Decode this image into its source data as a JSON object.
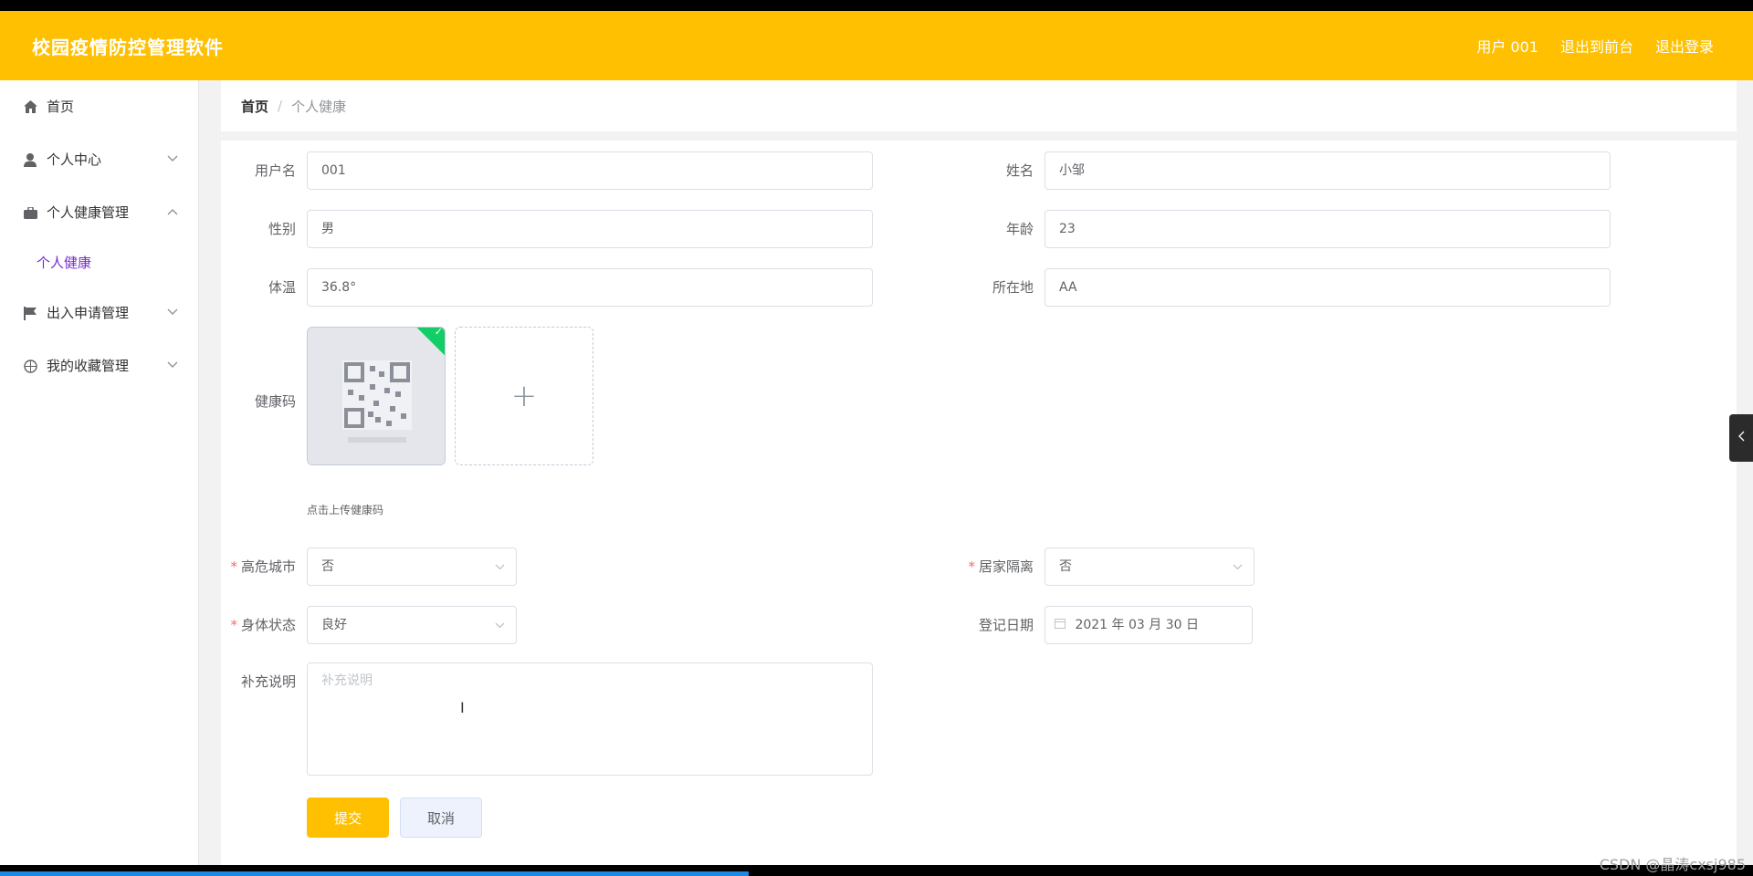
{
  "app": {
    "title": "校园疫情防控管理软件"
  },
  "topnav": {
    "user": "用户 001",
    "front": "退出到前台",
    "logout": "退出登录"
  },
  "sidebar": {
    "items": [
      {
        "label": "首页",
        "icon": "home-icon"
      },
      {
        "label": "个人中心",
        "icon": "user-icon",
        "arrow": "down"
      },
      {
        "label": "个人健康管理",
        "icon": "briefcase-icon",
        "arrow": "up"
      },
      {
        "label": "出入申请管理",
        "icon": "flag-icon",
        "arrow": "down"
      },
      {
        "label": "我的收藏管理",
        "icon": "compass-icon",
        "arrow": "down"
      }
    ],
    "sub": {
      "label": "个人健康"
    }
  },
  "breadcrumb": {
    "home": "首页",
    "separator": "/",
    "current": "个人健康"
  },
  "form": {
    "username": {
      "label": "用户名",
      "value": "001"
    },
    "name": {
      "label": "姓名",
      "value": "小邹"
    },
    "gender": {
      "label": "性别",
      "value": "男"
    },
    "age": {
      "label": "年龄",
      "value": "23"
    },
    "temperature": {
      "label": "体温",
      "value": "36.8°"
    },
    "location": {
      "label": "所在地",
      "value": "AA"
    },
    "healthcode": {
      "label": "健康码",
      "tip": "点击上传健康码",
      "add": "+"
    },
    "risk_city": {
      "label": "高危城市",
      "value": "否"
    },
    "home_quarantine": {
      "label": "居家隔离",
      "value": "否"
    },
    "body_status": {
      "label": "身体状态",
      "value": "良好"
    },
    "reg_date": {
      "label": "登记日期",
      "value": "2021 年 03 月 30 日"
    },
    "note": {
      "label": "补充说明",
      "placeholder": "补充说明"
    },
    "submit": "提交",
    "cancel": "取消"
  },
  "watermark": "CSDN @晶涛cxsj985",
  "colors": {
    "accent": "#fec000",
    "active_sub": "#7d2ad0",
    "success": "#13ce66"
  }
}
